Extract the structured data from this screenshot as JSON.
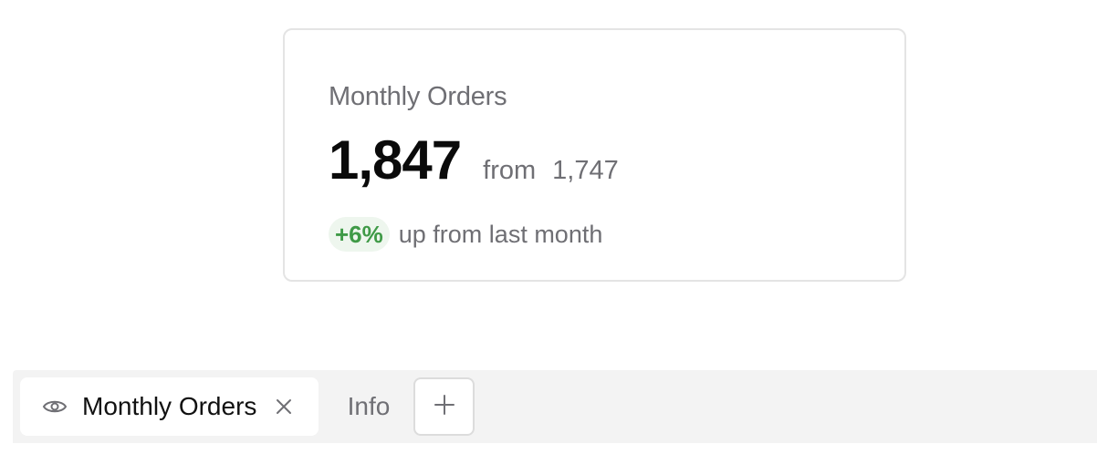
{
  "card": {
    "title": "Monthly Orders",
    "value": "1,847",
    "from_label": "from",
    "previous_value": "1,747",
    "change_badge": "+6%",
    "change_text": "up from last month"
  },
  "tabs": {
    "active": {
      "label": "Monthly Orders",
      "icon": "eye-icon",
      "close_icon": "close-icon"
    },
    "info_label": "Info",
    "add_icon": "plus-icon"
  },
  "colors": {
    "badge_text": "#3f9a47",
    "badge_bg": "#eef6ee",
    "muted_text": "#6f6f74",
    "tabbar_bg": "#f3f3f3"
  }
}
